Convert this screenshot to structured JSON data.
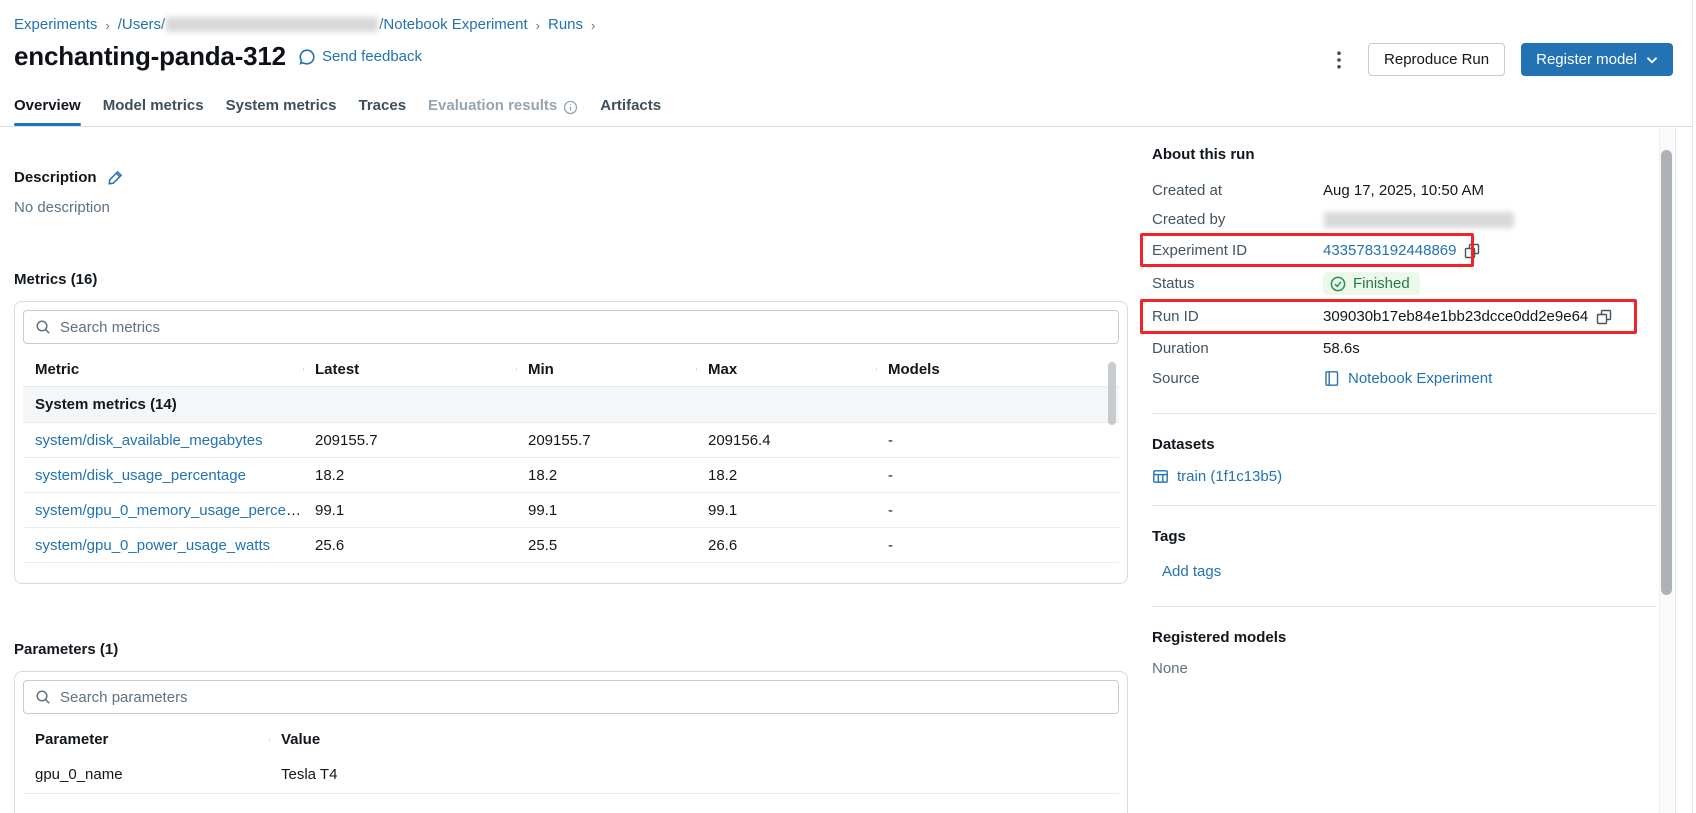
{
  "breadcrumb": {
    "experiments": "Experiments",
    "users_prefix": "/Users/",
    "notebook_suffix": "/Notebook Experiment",
    "runs": "Runs",
    "separator": "›"
  },
  "header": {
    "title": "enchanting-panda-312",
    "feedback_label": "Send feedback",
    "reproduce_button": "Reproduce Run",
    "register_button": "Register model"
  },
  "tabs": [
    {
      "label": "Overview",
      "active": true
    },
    {
      "label": "Model metrics"
    },
    {
      "label": "System metrics"
    },
    {
      "label": "Traces"
    },
    {
      "label": "Evaluation results",
      "disabled": true,
      "info": true
    },
    {
      "label": "Artifacts"
    }
  ],
  "description": {
    "heading": "Description",
    "empty_text": "No description"
  },
  "metrics": {
    "heading": "Metrics (16)",
    "search_placeholder": "Search metrics",
    "columns": [
      "Metric",
      "Latest",
      "Min",
      "Max",
      "Models"
    ],
    "group_label": "System metrics (14)",
    "rows": [
      {
        "metric": "system/disk_available_megabytes",
        "latest": "209155.7",
        "min": "209155.7",
        "max": "209156.4",
        "models": "-"
      },
      {
        "metric": "system/disk_usage_percentage",
        "latest": "18.2",
        "min": "18.2",
        "max": "18.2",
        "models": "-"
      },
      {
        "metric": "system/gpu_0_memory_usage_percenta...",
        "latest": "99.1",
        "min": "99.1",
        "max": "99.1",
        "models": "-"
      },
      {
        "metric": "system/gpu_0_power_usage_watts",
        "latest": "25.6",
        "min": "25.5",
        "max": "26.6",
        "models": "-"
      }
    ]
  },
  "parameters": {
    "heading": "Parameters (1)",
    "search_placeholder": "Search parameters",
    "columns": [
      "Parameter",
      "Value"
    ],
    "rows": [
      {
        "name": "gpu_0_name",
        "value": "Tesla T4"
      }
    ]
  },
  "about": {
    "heading": "About this run",
    "created_at_label": "Created at",
    "created_at": "Aug 17, 2025, 10:50 AM",
    "created_by_label": "Created by",
    "experiment_id_label": "Experiment ID",
    "experiment_id": "4335783192448869",
    "status_label": "Status",
    "status": "Finished",
    "run_id_label": "Run ID",
    "run_id": "309030b17eb84e1bb23dcce0dd2e9e64",
    "duration_label": "Duration",
    "duration": "58.6s",
    "source_label": "Source",
    "source": "Notebook Experiment"
  },
  "datasets": {
    "heading": "Datasets",
    "items": [
      {
        "label": "train (1f1c13b5)"
      }
    ]
  },
  "tags": {
    "heading": "Tags",
    "add_label": "Add tags"
  },
  "registered_models": {
    "heading": "Registered models",
    "value": "None"
  },
  "colors": {
    "accent_blue": "#2272B4",
    "status_green": "#277C43",
    "annotation_red": "#F2242A"
  }
}
